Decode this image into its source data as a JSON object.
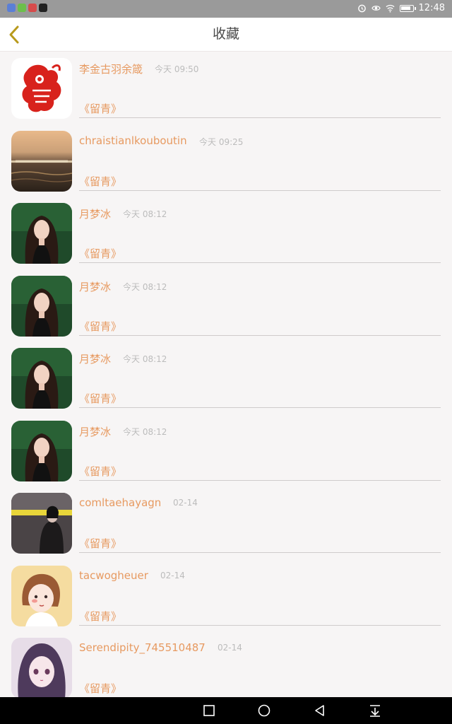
{
  "status_bar": {
    "time": "12:48",
    "left_icons": [
      "app-icon-1",
      "app-icon-2",
      "app-icon-3",
      "tiktok-icon"
    ],
    "right_icons": [
      "alarm-icon",
      "eye-icon",
      "wifi-icon",
      "battery-icon"
    ]
  },
  "header": {
    "title": "收藏",
    "back_icon": "chevron-left-icon"
  },
  "colors": {
    "accent": "#e79a61",
    "time_text": "#bcbcbc",
    "back_icon": "#b89a1c"
  },
  "items": [
    {
      "name": "李金古羽余箴",
      "time": "今天 09:50",
      "tag": "《留青》",
      "avatar": "red-paper-cut"
    },
    {
      "name": "chraistianlkouboutin",
      "time": "今天 09:25",
      "tag": "《留青》",
      "avatar": "sunset-sea"
    },
    {
      "name": "月梦冰",
      "time": "今天 08:12",
      "tag": "《留青》",
      "avatar": "girl-photo"
    },
    {
      "name": "月梦冰",
      "time": "今天 08:12",
      "tag": "《留青》",
      "avatar": "girl-photo"
    },
    {
      "name": "月梦冰",
      "time": "今天 08:12",
      "tag": "《留青》",
      "avatar": "girl-photo"
    },
    {
      "name": "月梦冰",
      "time": "今天 08:12",
      "tag": "《留青》",
      "avatar": "girl-photo"
    },
    {
      "name": "comltaehayagn",
      "time": "02-14",
      "tag": "《留青》",
      "avatar": "dark-photo"
    },
    {
      "name": "tacwogheuer",
      "time": "02-14",
      "tag": "《留青》",
      "avatar": "cartoon-girl"
    },
    {
      "name": "Serendipity_745510487",
      "time": "02-14",
      "tag": "《留青》",
      "avatar": "anime-girl"
    }
  ],
  "nav_bar": {
    "buttons": [
      "recents-square-icon",
      "home-circle-icon",
      "back-triangle-icon",
      "notification-pull-icon"
    ]
  }
}
